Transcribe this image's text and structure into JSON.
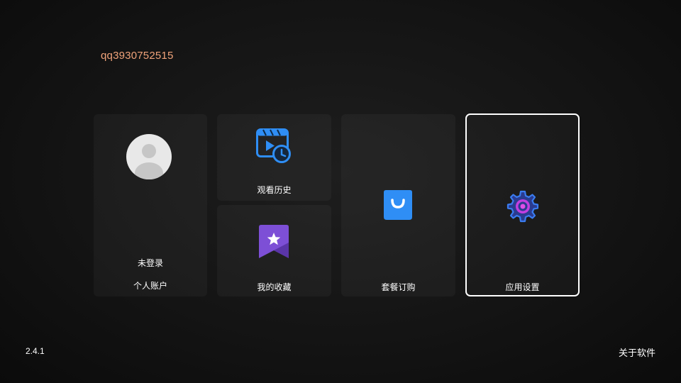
{
  "header": {
    "user_id": "qq3930752515"
  },
  "tiles": {
    "account": {
      "status": "未登录",
      "label": "个人账户",
      "icon": "avatar-placeholder-icon"
    },
    "history": {
      "label": "观看历史",
      "icon": "video-history-icon"
    },
    "favorites": {
      "label": "我的收藏",
      "icon": "star-bookmark-icon"
    },
    "plans": {
      "label": "套餐订购",
      "icon": "shopping-bag-icon"
    },
    "settings": {
      "label": "应用设置",
      "icon": "gear-icon"
    }
  },
  "footer": {
    "version": "2.4.1",
    "about": "关于软件"
  },
  "colors": {
    "user_id": "#f0a37a",
    "accent_blue": "#2f8ef5",
    "accent_purple": "#7d4fd6",
    "focus_border": "#ffffff"
  }
}
